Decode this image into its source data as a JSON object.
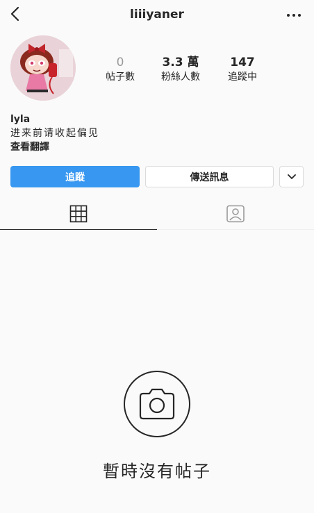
{
  "header": {
    "username": "liiiyaner",
    "back_icon": "chevron-left-icon",
    "more_icon": "more-horizontal-icon"
  },
  "profile": {
    "avatar_icon": "avatar",
    "stats": [
      {
        "value": "0",
        "label": "帖子數"
      },
      {
        "value": "3.3 萬",
        "label": "粉絲人數"
      },
      {
        "value": "147",
        "label": "追蹤中"
      }
    ],
    "name": "lyla",
    "bio": "进来前请收起偏见",
    "translate_label": "查看翻譯"
  },
  "actions": {
    "follow_label": "追蹤",
    "message_label": "傳送訊息",
    "more_icon": "chevron-down-icon"
  },
  "tabs": [
    {
      "icon": "grid-icon"
    },
    {
      "icon": "tagged-user-icon"
    }
  ],
  "empty_state": {
    "icon": "camera-icon",
    "text": "暫時沒有帖子"
  },
  "colors": {
    "accent": "#3897f0",
    "background": "#fafafa",
    "border": "#dbdbdb"
  }
}
